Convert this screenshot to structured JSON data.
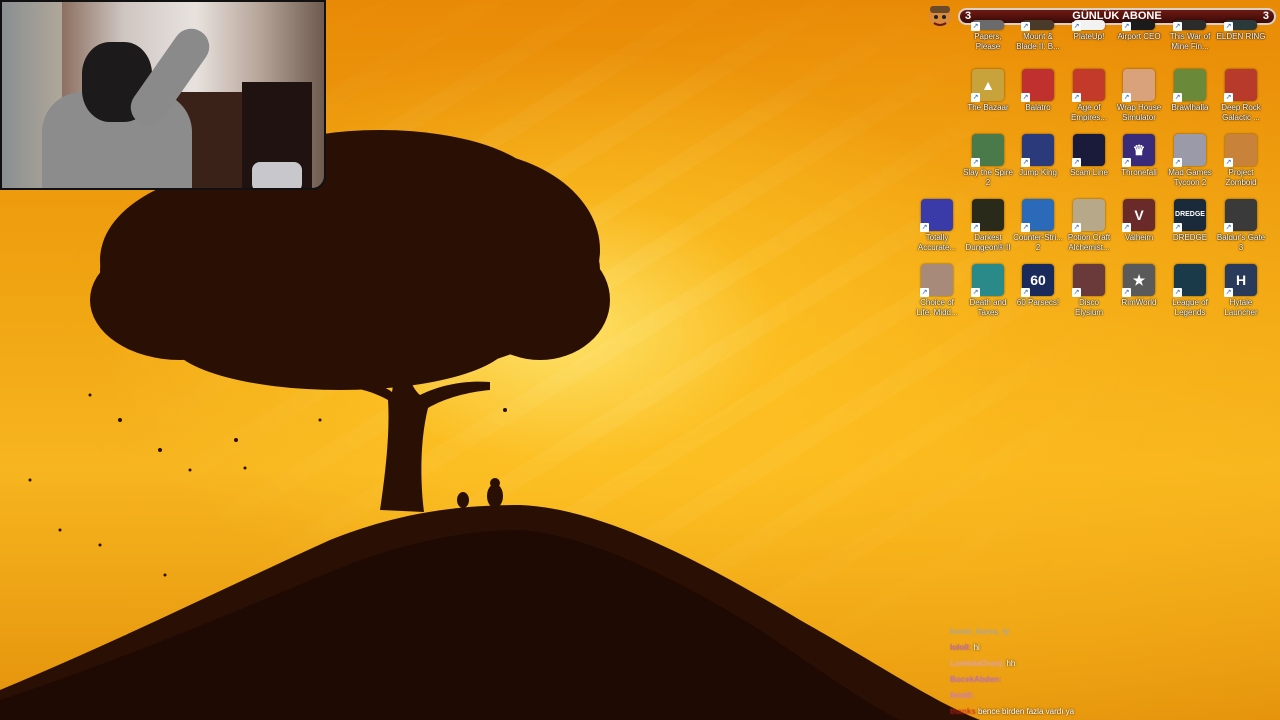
{
  "subgoal": {
    "left_count": "3",
    "title": "GÜNLÜK ABONE",
    "right_count": "3"
  },
  "icons": [
    {
      "label": "Papers, Please",
      "color": "#6b6b6b",
      "glyph": ""
    },
    {
      "label": "Mount & Blade II: B...",
      "color": "#4a3a2a",
      "glyph": ""
    },
    {
      "label": "PlateUp!",
      "color": "#f2f2f2",
      "glyph": ""
    },
    {
      "label": "Airport CEO",
      "color": "#1b1b1b",
      "glyph": ""
    },
    {
      "label": "This War of Mine Fin...",
      "color": "#2b2b2b",
      "glyph": ""
    },
    {
      "label": "ELDEN RING",
      "color": "#2a3a3a",
      "glyph": ""
    },
    {
      "label": "The Bazaar",
      "color": "#c8a23a",
      "glyph": "▲"
    },
    {
      "label": "Balatro",
      "color": "#c0302f",
      "glyph": ""
    },
    {
      "label": "Age of Empires...",
      "color": "#c43a2a",
      "glyph": ""
    },
    {
      "label": "Wrap House Simulator",
      "color": "#d9a27a",
      "glyph": ""
    },
    {
      "label": "Brawlhalla",
      "color": "#6a8a3a",
      "glyph": ""
    },
    {
      "label": "Deep Rock Galactic ...",
      "color": "#b83a2a",
      "glyph": ""
    },
    {
      "label": "Slay the Spire 2",
      "color": "#4a7a4a",
      "glyph": ""
    },
    {
      "label": "Jump King",
      "color": "#2a3a7a",
      "glyph": ""
    },
    {
      "label": "Scam Line",
      "color": "#1a1a3a",
      "glyph": ""
    },
    {
      "label": "Thronefall",
      "color": "#3a2a7a",
      "glyph": "♛"
    },
    {
      "label": "Mad Games Tycoon 2",
      "color": "#9a9aa8",
      "glyph": ""
    },
    {
      "label": "Project Zomboid",
      "color": "#c8823a",
      "glyph": ""
    },
    {
      "label": "Totally Accurate...",
      "color": "#3a3aa8",
      "glyph": ""
    },
    {
      "label": "Darkest Dungeon® II",
      "color": "#2a2a1a",
      "glyph": ""
    },
    {
      "label": "Counter-Stri... 2",
      "color": "#2a6ab8",
      "glyph": ""
    },
    {
      "label": "Potion Craft Alchemist...",
      "color": "#b8a88a",
      "glyph": ""
    },
    {
      "label": "Valheim",
      "color": "#6a2a2a",
      "glyph": "V"
    },
    {
      "label": "DREDGE",
      "color": "#1a2a3a",
      "glyph": "DREDGE"
    },
    {
      "label": "Baldur's Gate 3",
      "color": "#3a3a3a",
      "glyph": ""
    },
    {
      "label": "Choice of Life: Midd...",
      "color": "#a88a7a",
      "glyph": ""
    },
    {
      "label": "Death and Taxes",
      "color": "#2a8a8a",
      "glyph": ""
    },
    {
      "label": "60 Parsecs!",
      "color": "#1a2a5a",
      "glyph": "60"
    },
    {
      "label": "Disco Elysium",
      "color": "#6a3a3a",
      "glyph": ""
    },
    {
      "label": "RimWorld",
      "color": "#5a5a5a",
      "glyph": "★"
    },
    {
      "label": "League of Legends",
      "color": "#1a3a4a",
      "glyph": ""
    },
    {
      "label": "Hytale Launcher",
      "color": "#2a3a5a",
      "glyph": "H"
    }
  ],
  "chat": [
    {
      "name": "kuran_kursu_ty",
      "name_color": "#9aa6b6",
      "message": ""
    },
    {
      "name": "lololl:",
      "name_color": "#9a4ad0",
      "message": "hi"
    },
    {
      "name": "LambdaOranj:",
      "name_color": "#d8a0c8",
      "message": "hh"
    },
    {
      "name": "BocekAbden:",
      "name_color": "#a860e0",
      "message": ""
    },
    {
      "name": "feint0:",
      "name_color": "#c070e8",
      "message": ""
    },
    {
      "name": "thanks",
      "name_color": "#c02020",
      "message": "bence birden fazla vardı ya"
    }
  ],
  "colors": {
    "sky_top": "#e98a06",
    "sky_glow": "#ffe278",
    "silhouette": "#2a0f04"
  }
}
